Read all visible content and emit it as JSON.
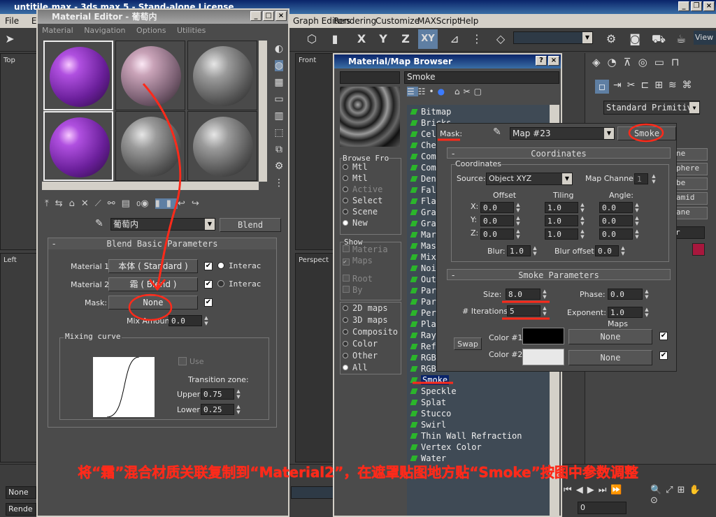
{
  "app": {
    "title": "untitile.max - 3ds max 5 - Stand-alone License",
    "menu": [
      "File",
      "Edit",
      "Graph Editors",
      "Rendering",
      "Customize",
      "MAXScript",
      "Help"
    ],
    "view_label": "View",
    "axes": [
      "X",
      "Y",
      "Z",
      "XY"
    ],
    "viewports": {
      "top": "Top",
      "front": "Front",
      "left": "Left",
      "perspective": "Perspect"
    },
    "status": {
      "none": "None",
      "render": "Rende",
      "frame": "0"
    },
    "create_panel": {
      "dropdown": "Standard Primitiv",
      "items": [
        "ne",
        "phere",
        "be",
        "amid",
        "ane",
        "r"
      ]
    }
  },
  "material_editor": {
    "title": "Material Editor - 葡萄内",
    "menu": [
      "Material",
      "Navigation",
      "Options",
      "Utilities"
    ],
    "material_name": "葡萄内",
    "type_button": "Blend",
    "zero_label": "0",
    "rollout_title": "Blend Basic Parameters",
    "material1_label": "Material 1:",
    "material1_value": "本体 ( Standard )",
    "material2_label": "Material 2:",
    "material2_value": "霜 ( Blend )",
    "interactive": "Interac",
    "mask_label": "Mask:",
    "mask_value": "None",
    "mix_amount_label": "Mix Amount:",
    "mix_amount_value": "0.0",
    "mixing_curve_label": "Mixing curve",
    "use_label": "Use",
    "transition_label": "Transition zone:",
    "upper_label": "Upper:",
    "upper_value": "0.75",
    "lower_label": "Lower:",
    "lower_value": "0.25"
  },
  "map_browser": {
    "title": "Material/Map Browser",
    "search_value": "Smoke",
    "browse_from_label": "Browse Fro",
    "browse_options": [
      "Mtl",
      "Mtl",
      "Active",
      "Select",
      "Scene",
      "New"
    ],
    "show_label": "Show",
    "show_options": [
      "Materia",
      "Maps"
    ],
    "other_options": [
      "Root",
      "By"
    ],
    "filter_options": [
      "2D maps",
      "3D maps",
      "Composito",
      "Color",
      "Other",
      "All"
    ],
    "items": [
      "Bitmap",
      "Bricks",
      "Cel",
      "Che",
      "Com",
      "Com",
      "Den",
      "Fal",
      "Fla",
      "Gra",
      "Gra",
      "Mar",
      "Mas",
      "Mix",
      "Noi",
      "Out",
      "Par",
      "Par",
      "Per",
      "Pla",
      "Ray",
      "Ref",
      "RGB",
      "RGB",
      "Smoke",
      "Speckle",
      "Splat",
      "Stucco",
      "Swirl",
      "Thin Wall Refraction",
      "Vertex Color",
      "Water"
    ],
    "selected_index": 24
  },
  "smoke_panel": {
    "mask_label": "Mask:",
    "map_name": "Map #23",
    "map_type": "Smoke",
    "coordinates_title": "Coordinates",
    "coordinates_group": "Coordinates",
    "source_label": "Source:",
    "source_value": "Object XYZ",
    "map_channel_label": "Map Channel:",
    "map_channel_value": "1",
    "offset_label": "Offset",
    "tiling_label": "Tiling",
    "angle_label": "Angle:",
    "rows": [
      {
        "axis": "X:",
        "offset": "0.0",
        "tiling": "1.0",
        "angle": "0.0"
      },
      {
        "axis": "Y:",
        "offset": "0.0",
        "tiling": "1.0",
        "angle": "0.0"
      },
      {
        "axis": "Z:",
        "offset": "0.0",
        "tiling": "1.0",
        "angle": "0.0"
      }
    ],
    "blur_label": "Blur:",
    "blur_value": "1.0",
    "blur_offset_label": "Blur offset:",
    "blur_offset_value": "0.0",
    "smoke_title": "Smoke Parameters",
    "size_label": "Size:",
    "size_value": "8.0",
    "phase_label": "Phase:",
    "phase_value": "0.0",
    "iterations_label": "# Iterations:",
    "iterations_value": "5",
    "exponent_label": "Exponent:",
    "exponent_value": "1.0",
    "maps_label": "Maps",
    "swap_label": "Swap",
    "color1_label": "Color #1",
    "color1": "#000000",
    "color1_map": "None",
    "color2_label": "Color #2",
    "color2": "#e8e8e8",
    "color2_map": "None"
  },
  "caption": "将“霜”混合材质关联复制到“Material2”，在遮罩贴图地方贴“Smoke”按图中参数调整",
  "colors": {
    "annotation": "#ff2a1a",
    "caption": "#ff2a1a",
    "swatch_red": "#a8173d"
  }
}
